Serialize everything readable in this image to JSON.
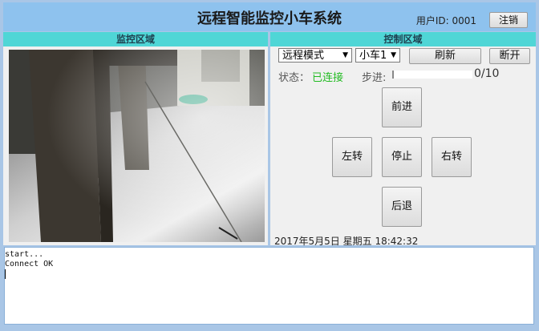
{
  "header": {
    "title": "远程智能监控小车系统",
    "user_label": "用户ID: 0001",
    "logout_label": "注销"
  },
  "monitor": {
    "heading": "监控区域"
  },
  "control": {
    "heading": "控制区域",
    "mode_select": {
      "value": "远程模式"
    },
    "car_select": {
      "value": "小车1"
    },
    "refresh_label": "刷新",
    "disconnect_label": "断开",
    "status_label": "状态：",
    "status_value": "已连接",
    "status_color": "#22bb22",
    "step_label": "步进:",
    "step_current": 0,
    "step_total": 10,
    "step_text": "0/10",
    "buttons": {
      "forward": "前进",
      "left": "左转",
      "stop": "停止",
      "right": "右转",
      "back": "后退"
    },
    "datetime": "2017年5月5日 星期五 18:42:32"
  },
  "log": {
    "lines": [
      "start...",
      "Connect OK"
    ]
  },
  "colors": {
    "header_bg": "#8ec2ee",
    "section_header_bg": "#4fd6d6",
    "panel_bg": "#f0f0f0"
  }
}
